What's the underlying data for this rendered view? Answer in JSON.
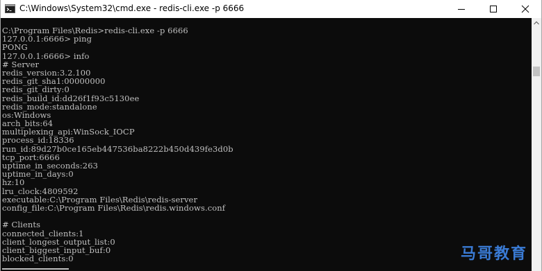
{
  "window": {
    "title": "C:\\Windows\\System32\\cmd.exe - redis-cli.exe  -p 6666",
    "icon": "cmd-prompt-icon"
  },
  "controls": {
    "minimize": "minimize-icon",
    "maximize": "maximize-icon",
    "close": "close-icon"
  },
  "console": {
    "lines": [
      "C:\\Program Files\\Redis>redis-cli.exe -p 6666",
      "127.0.0.1:6666> ping",
      "PONG",
      "127.0.0.1:6666> info",
      "# Server",
      "redis_version:3.2.100",
      "redis_git_sha1:00000000",
      "redis_git_dirty:0",
      "redis_build_id:dd26f1f93c5130ee",
      "redis_mode:standalone",
      "os:Windows",
      "arch_bits:64",
      "multiplexing_api:WinSock_IOCP",
      "process_id:18336",
      "run_id:89d27b0ce165eb447536ba8222b450d439fe3d0b",
      "tcp_port:6666",
      "uptime_in_seconds:263",
      "uptime_in_days:0",
      "hz:10",
      "lru_clock:4809592",
      "executable:C:\\Program Files\\Redis\\redis-server",
      "config_file:C:\\Program Files\\Redis\\redis.windows.conf",
      "",
      "# Clients",
      "connected_clients:1",
      "client_longest_output_list:0",
      "client_biggest_input_buf:0",
      "blocked_clients:0"
    ]
  },
  "watermark": "马哥教育",
  "colors": {
    "console_bg": "#0c0c0c",
    "console_text": "#c0c0c0",
    "watermark": "#3a7bd5"
  }
}
